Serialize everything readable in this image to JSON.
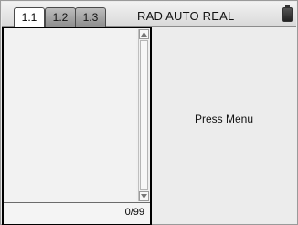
{
  "tabs": [
    {
      "label": "1.1",
      "active": true
    },
    {
      "label": "1.2",
      "active": false
    },
    {
      "label": "1.3",
      "active": false
    }
  ],
  "status": {
    "mode": "RAD AUTO REAL",
    "battery_icon": "battery-icon"
  },
  "calculator": {
    "history_counter": "0/99"
  },
  "right_pane": {
    "prompt": "Press Menu"
  },
  "colors": {
    "active_tab": "#ffffff",
    "inactive_tab": "#9e9e9e",
    "pane_border": "#000000"
  }
}
